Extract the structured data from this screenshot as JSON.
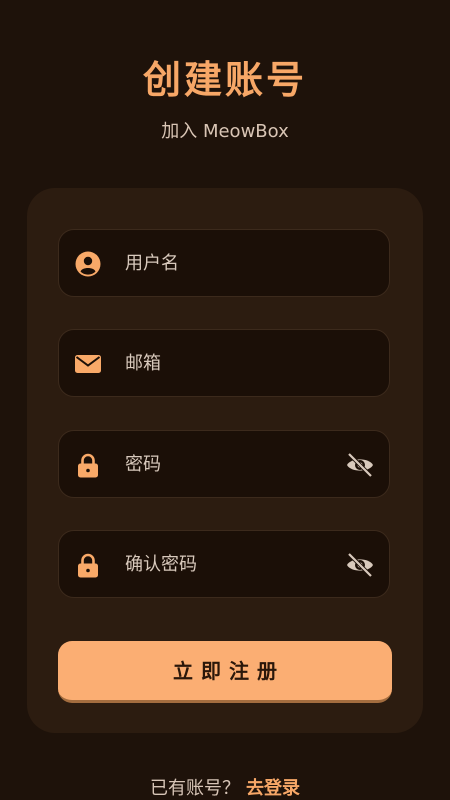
{
  "header": {
    "title": "创建账号",
    "subtitle": "加入 MeowBox"
  },
  "form": {
    "username_placeholder": "用户名",
    "email_placeholder": "邮箱",
    "password_placeholder": "密码",
    "confirm_password_placeholder": "确认密码",
    "submit_label": "立即注册"
  },
  "icons": {
    "username": "user-circle-icon",
    "email": "envelope-icon",
    "password": "lock-icon",
    "password_toggle": "eye-slash-icon"
  },
  "footer": {
    "prompt": "已有账号？",
    "login_link": "去登录"
  },
  "colors": {
    "background": "#1e120a",
    "card": "#2c1c10",
    "accent": "#f7a767",
    "button": "#fbae73"
  }
}
